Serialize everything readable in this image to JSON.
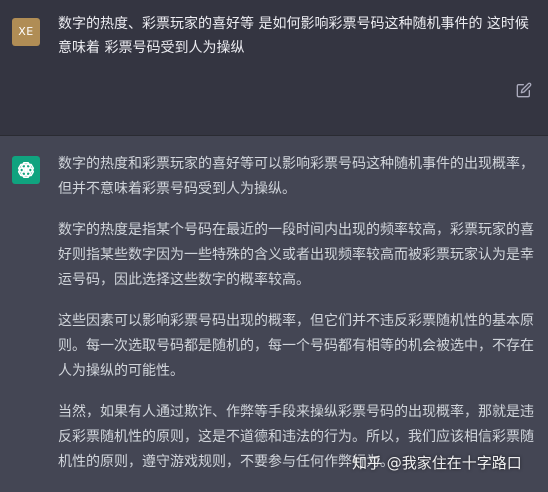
{
  "user_message": {
    "avatar_initials": "XE",
    "text": "数字的热度、彩票玩家的喜好等 是如何影响彩票号码这种随机事件的  这时候意味着 彩票号码受到人为操纵",
    "edit_icon": "edit-icon"
  },
  "assistant_message": {
    "avatar_icon": "openai-logo-icon",
    "paragraphs": [
      "数字的热度和彩票玩家的喜好等可以影响彩票号码这种随机事件的出现概率，但并不意味着彩票号码受到人为操纵。",
      "数字的热度是指某个号码在最近的一段时间内出现的频率较高，彩票玩家的喜好则指某些数字因为一些特殊的含义或者出现频率较高而被彩票玩家认为是幸运号码，因此选择这些数字的概率较高。",
      "这些因素可以影响彩票号码出现的概率，但它们并不违反彩票随机性的基本原则。每一次选取号码都是随机的，每一个号码都有相等的机会被选中，不存在人为操纵的可能性。",
      "当然，如果有人通过欺诈、作弊等手段来操纵彩票号码的出现概率，那就是违反彩票随机性的原则，这是不道德和违法的行为。所以，我们应该相信彩票随机性的原则，遵守游戏规则，不要参与任何作弊行为。"
    ]
  },
  "watermark": "知乎 @我家住在十字路口",
  "colors": {
    "user_bg": "#343541",
    "assistant_bg": "#444654",
    "gpt_green": "#10a37f",
    "user_avatar": "#b08d55"
  }
}
